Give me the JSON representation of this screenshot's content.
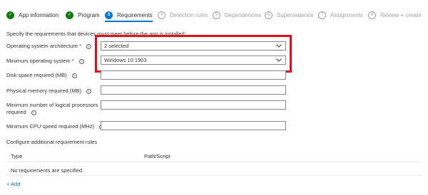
{
  "wizard": {
    "steps": [
      {
        "label": "App information",
        "icon": "check-icon",
        "state": "done"
      },
      {
        "label": "Program",
        "icon": "check-icon",
        "state": "done"
      },
      {
        "label": "Requirements",
        "number": "3",
        "state": "current"
      },
      {
        "label": "Detection rules",
        "number": "4",
        "state": "todo"
      },
      {
        "label": "Dependencies",
        "number": "5",
        "state": "todo"
      },
      {
        "label": "Supersedence",
        "number": "6",
        "state": "todo"
      },
      {
        "label": "Assignments",
        "number": "7",
        "state": "todo"
      },
      {
        "label": "Review + create",
        "number": "8",
        "state": "todo"
      }
    ]
  },
  "intro": "Specify the requirements that devices must meet before the app is installed:",
  "form": {
    "os_architecture": {
      "label": "Operating system architecture",
      "required_mark": "*",
      "value": "2 selected"
    },
    "min_os": {
      "label": "Minimum operating system",
      "required_mark": "*",
      "value": "Windows 10 1903"
    },
    "disk_space": {
      "label": "Disk space required (MB)",
      "value": ""
    },
    "physical_memory": {
      "label": "Physical memory required (MB)",
      "value": ""
    },
    "min_processors": {
      "label_line1": "Minimum number of logical processors",
      "label_line2": "required",
      "value": ""
    },
    "min_cpu_speed": {
      "label": "Minimum CPU speed required (MHz)",
      "value": ""
    }
  },
  "additional_rules": {
    "heading": "Configure additional requirement rules",
    "columns": [
      "Type",
      "Path/Script"
    ],
    "empty_text": "No requirements are specified.",
    "add_label": "+ Add"
  },
  "colors": {
    "accent": "#0078d4",
    "success": "#107c10",
    "highlight": "#e0101a",
    "required": "#a4262c"
  }
}
